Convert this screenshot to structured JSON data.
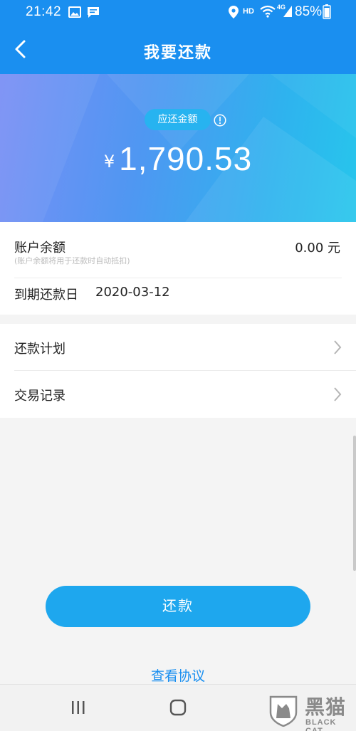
{
  "status_bar": {
    "time": "21:42",
    "hd": "HD",
    "network": "4G",
    "battery": "85%"
  },
  "header": {
    "title": "我要还款"
  },
  "summary": {
    "badge": "应还金额",
    "currency": "¥",
    "amount": "1,790.53"
  },
  "account": {
    "balance_label": "账户余额",
    "balance_note": "(账户余额将用于还款时自动抵扣)",
    "balance_value": "0.00 元",
    "due_label": "到期还款日",
    "due_date": "2020-03-12"
  },
  "menu": [
    {
      "label": "还款计划"
    },
    {
      "label": "交易记录"
    }
  ],
  "actions": {
    "repay_label": "还款",
    "agreement_label": "查看协议"
  },
  "watermark": {
    "cn": "黑猫",
    "en": "BLACK CAT"
  },
  "colors": {
    "primary": "#1a8ff0",
    "button": "#1ea7ee",
    "gradient_start": "#7a8ff5",
    "gradient_end": "#27c6ec"
  },
  "icons": [
    "back-arrow-icon",
    "info-icon",
    "chevron-right-icon",
    "recent-apps-icon",
    "home-icon",
    "back-icon"
  ]
}
